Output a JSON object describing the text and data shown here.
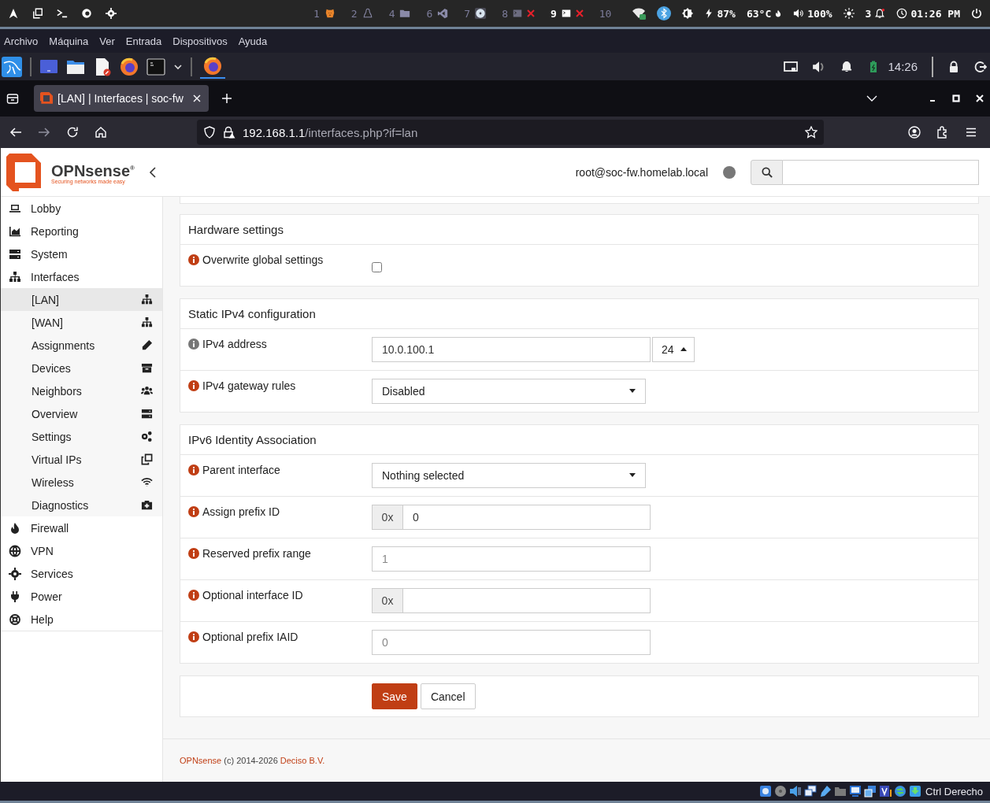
{
  "system_bar": {
    "workspaces": [
      {
        "number": "1",
        "selected": false
      },
      {
        "number": "2",
        "selected": false
      },
      {
        "number": "4",
        "selected": false
      },
      {
        "number": "6",
        "selected": false
      },
      {
        "number": "7",
        "selected": false
      },
      {
        "number": "8",
        "selected": false
      },
      {
        "number": "9",
        "selected": true
      },
      {
        "number": "10",
        "selected": false
      }
    ],
    "battery": "87%",
    "temperature": "63°C",
    "volume": "100%",
    "notifications": "3",
    "clock": "01:26 PM"
  },
  "vm_menu": [
    "Archivo",
    "Máquina",
    "Ver",
    "Entrada",
    "Dispositivos",
    "Ayuda"
  ],
  "taskbar": {
    "clock": "14:26"
  },
  "browser": {
    "tab_title": "[LAN] | Interfaces | soc-fw",
    "url_host": "192.168.1.1",
    "url_path": "/interfaces.php?if=lan"
  },
  "header": {
    "brand": "OPNsense",
    "trademark": "®",
    "tagline": "Securing networks made easy",
    "user": "root@soc-fw.homelab.local"
  },
  "sidebar": {
    "items": [
      {
        "label": "Lobby"
      },
      {
        "label": "Reporting"
      },
      {
        "label": "System"
      },
      {
        "label": "Interfaces",
        "children": [
          {
            "label": "[LAN]",
            "selected": true
          },
          {
            "label": "[WAN]",
            "selected": false
          },
          {
            "label": "Assignments",
            "selected": false
          },
          {
            "label": "Devices",
            "selected": false
          },
          {
            "label": "Neighbors",
            "selected": false
          },
          {
            "label": "Overview",
            "selected": false
          },
          {
            "label": "Settings",
            "selected": false
          },
          {
            "label": "Virtual IPs",
            "selected": false
          },
          {
            "label": "Wireless",
            "selected": false
          },
          {
            "label": "Diagnostics",
            "selected": false
          }
        ]
      },
      {
        "label": "Firewall"
      },
      {
        "label": "VPN"
      },
      {
        "label": "Services"
      },
      {
        "label": "Power"
      },
      {
        "label": "Help"
      }
    ]
  },
  "sections": [
    {
      "title": "Hardware settings",
      "rows": [
        {
          "kind": "checkbox",
          "label": "Overwrite global settings",
          "color": "#c03e14",
          "checked": false
        }
      ]
    },
    {
      "title": "Static IPv4 configuration",
      "rows": [
        {
          "kind": "address",
          "label": "IPv4 address",
          "color": "#777777",
          "value": "10.0.100.1",
          "suffix": "24"
        },
        {
          "kind": "select",
          "label": "IPv4 gateway rules",
          "color": "#c03e14",
          "value": "Disabled"
        }
      ]
    },
    {
      "title": "IPv6 Identity Association",
      "rows": [
        {
          "kind": "select",
          "label": "Parent interface",
          "color": "#c03e14",
          "value": "Nothing selected"
        },
        {
          "kind": "prefixed",
          "label": "Assign prefix ID",
          "color": "#c03e14",
          "prefix": "0x",
          "value": "0"
        },
        {
          "kind": "text",
          "label": "Reserved prefix range",
          "color": "#c03e14",
          "placeholder": "1"
        },
        {
          "kind": "prefixed",
          "label": "Optional interface ID",
          "color": "#c03e14",
          "prefix": "0x"
        },
        {
          "kind": "text",
          "label": "Optional prefix IAID",
          "color": "#c03e14",
          "placeholder": "0"
        }
      ]
    }
  ],
  "actions": [
    {
      "label": "Save",
      "kind": "primary"
    },
    {
      "label": "Cancel",
      "kind": "secondary"
    }
  ],
  "footer": {
    "brand_link": "OPNsense",
    "text": "(c) 2014-2026",
    "company_link": "Deciso B.V."
  },
  "vm_status": {
    "keyboard_hint": "Ctrl Derecho"
  }
}
